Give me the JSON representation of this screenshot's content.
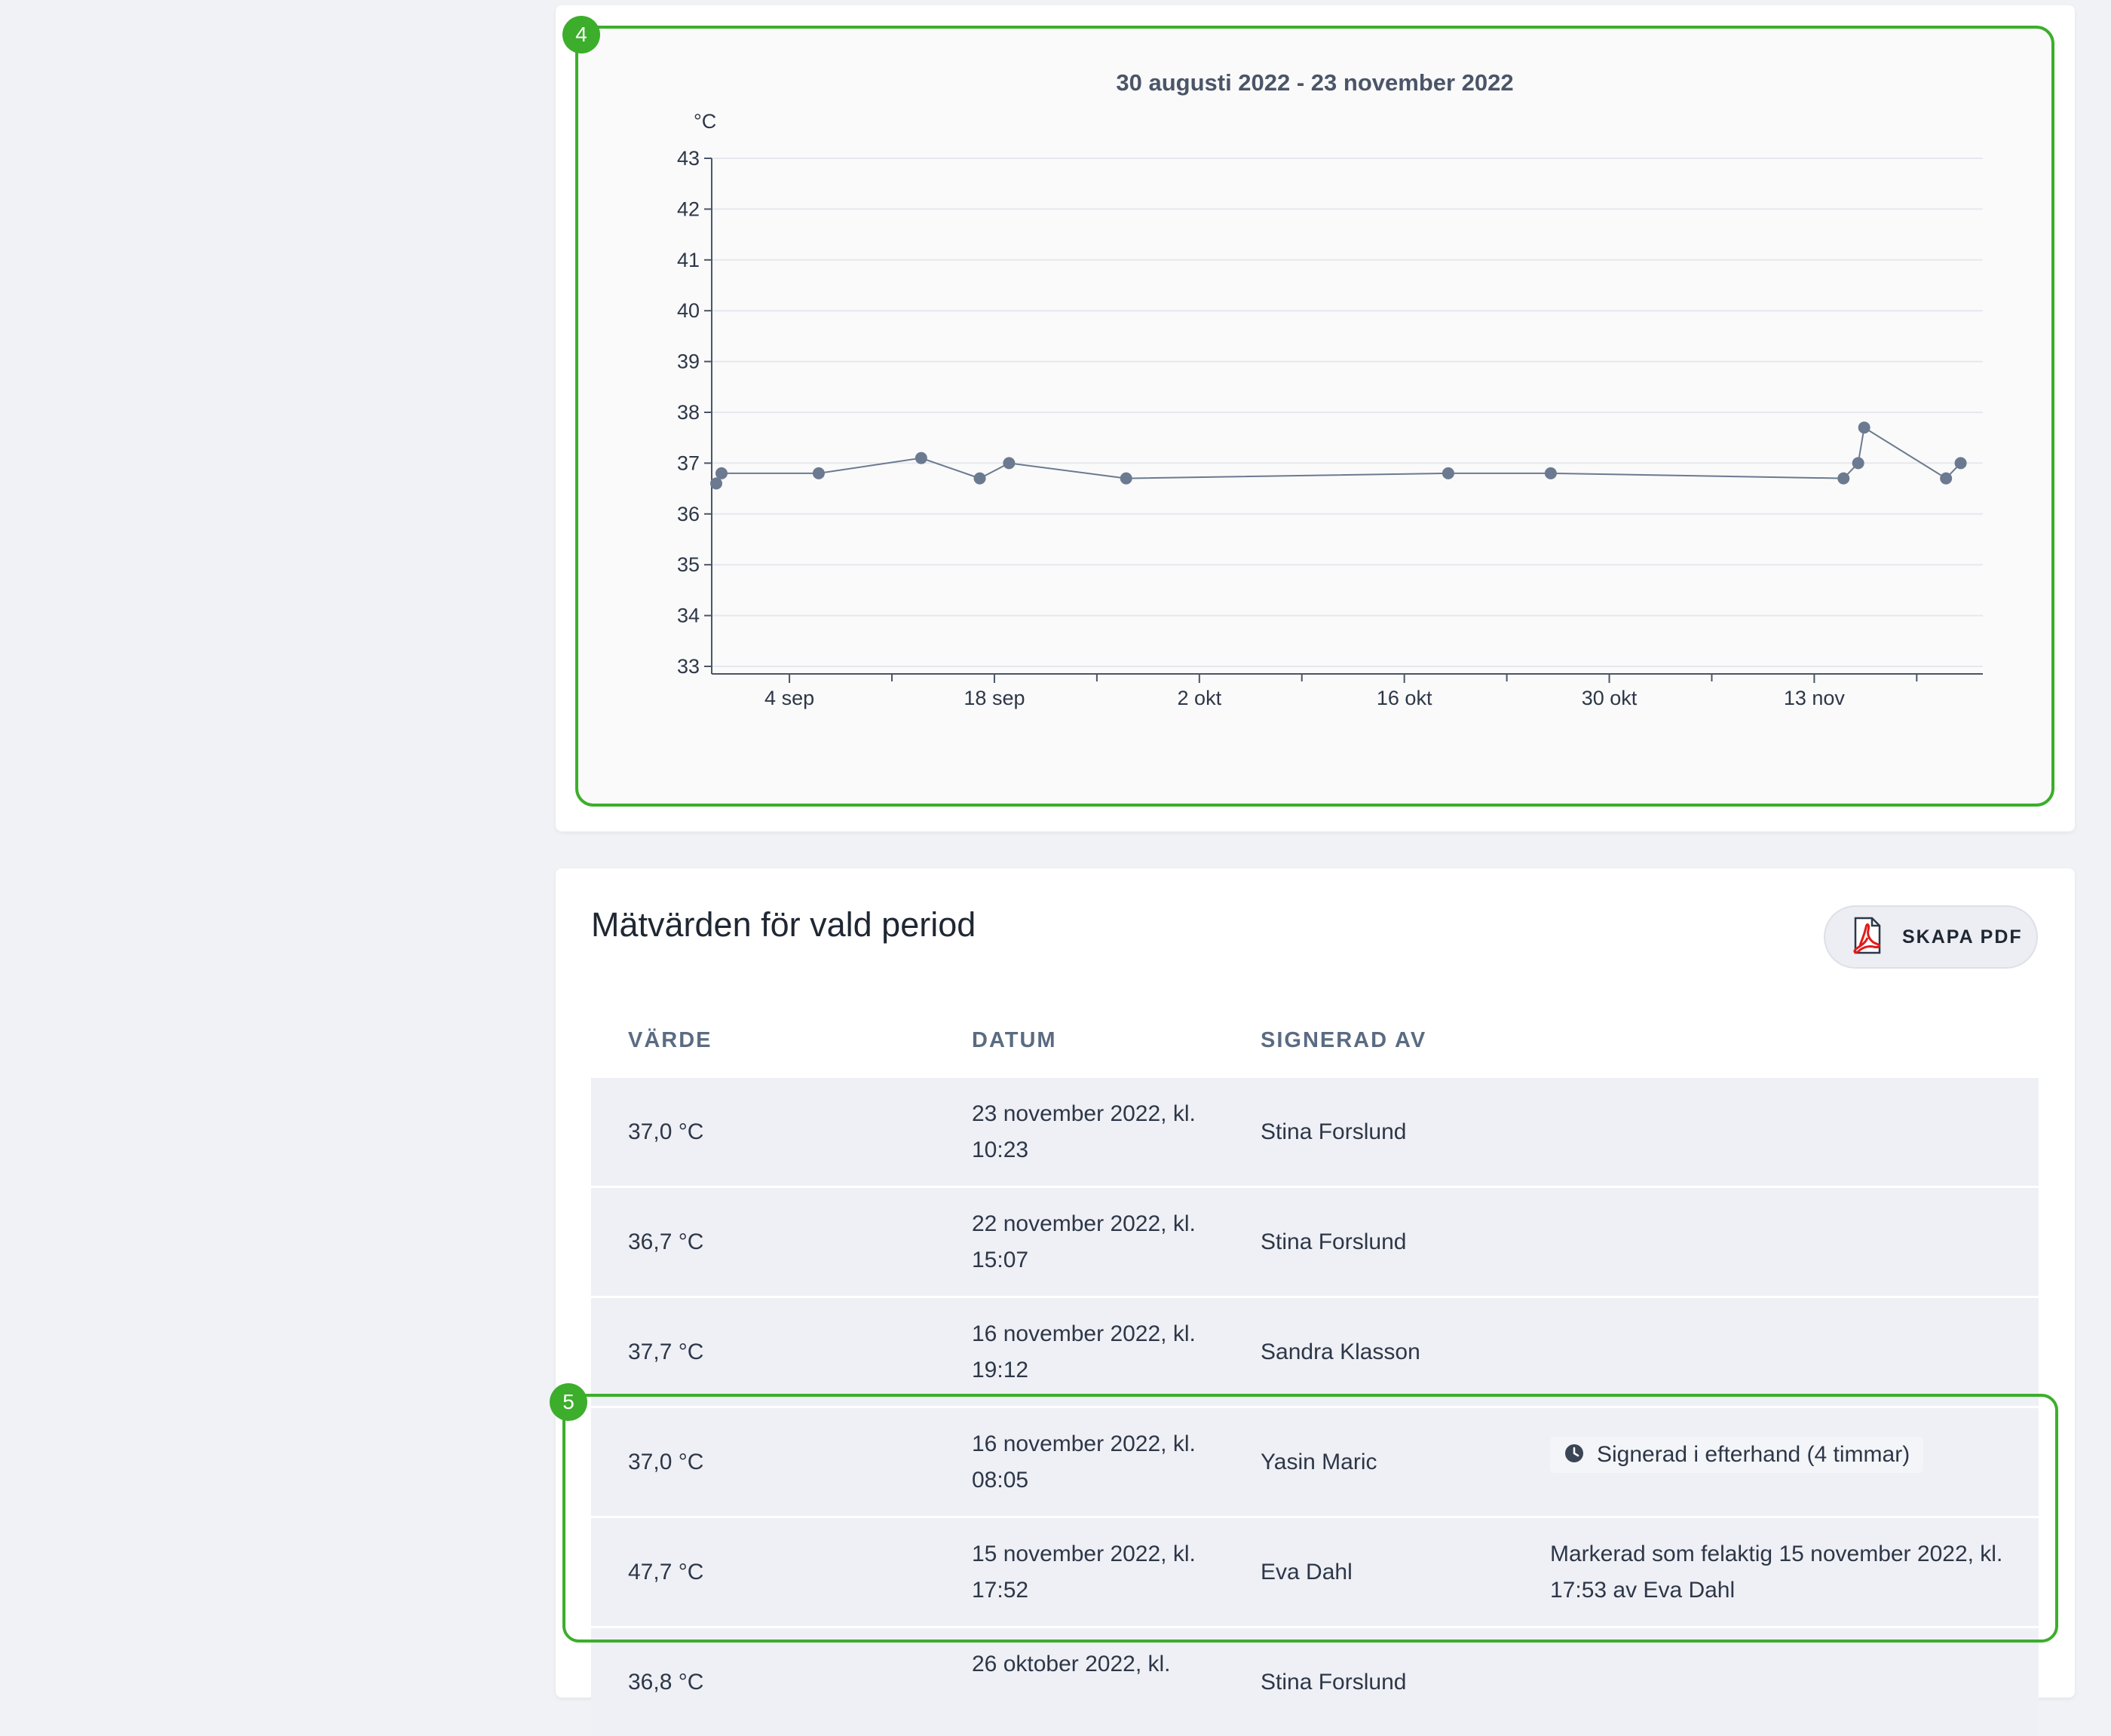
{
  "chart": {
    "badge": "4",
    "unit": "°C"
  },
  "chart_data": {
    "type": "line",
    "title": "30 augusti 2022 - 23 november 2022",
    "ylabel": "°C",
    "ylim": [
      33,
      43
    ],
    "yticks": [
      "33",
      "34",
      "35",
      "36",
      "37",
      "38",
      "39",
      "40",
      "41",
      "42",
      "43"
    ],
    "xlim": [
      "2022-08-30",
      "2022-11-24"
    ],
    "xticks": [
      {
        "date": "2022-09-04",
        "label": "4 sep"
      },
      {
        "date": "2022-09-18",
        "label": "18 sep"
      },
      {
        "date": "2022-10-02",
        "label": "2 okt"
      },
      {
        "date": "2022-10-16",
        "label": "16 okt"
      },
      {
        "date": "2022-10-30",
        "label": "30 okt"
      },
      {
        "date": "2022-11-13",
        "label": "13 nov"
      }
    ],
    "minor_xticks": [
      "2022-09-11",
      "2022-09-25",
      "2022-10-09",
      "2022-10-23",
      "2022-11-06",
      "2022-11-20"
    ],
    "grid": true,
    "series": [
      {
        "color": "#6b7a90",
        "points": [
          {
            "x": "2022-08-30",
            "y": 36.6
          },
          {
            "x": "2022-08-30",
            "y": 36.8
          },
          {
            "x": "2022-09-06",
            "y": 36.8
          },
          {
            "x": "2022-09-13",
            "y": 37.1
          },
          {
            "x": "2022-09-17",
            "y": 36.7
          },
          {
            "x": "2022-09-19",
            "y": 37.0
          },
          {
            "x": "2022-09-27",
            "y": 36.7
          },
          {
            "x": "2022-10-19",
            "y": 36.8
          },
          {
            "x": "2022-10-26",
            "y": 36.8
          },
          {
            "x": "2022-11-15",
            "y": 36.7
          },
          {
            "x": "2022-11-16",
            "y": 37.0
          },
          {
            "x": "2022-11-16",
            "y": 37.7
          },
          {
            "x": "2022-11-22",
            "y": 36.7
          },
          {
            "x": "2022-11-23",
            "y": 37.0
          }
        ]
      }
    ]
  },
  "table": {
    "title": "Mätvärden för vald period",
    "pdf_button": "SKAPA PDF",
    "pdf_icon": "pdf-icon",
    "headers": {
      "value": "VÄRDE",
      "date": "DATUM",
      "signed_by": "SIGNERAD AV"
    },
    "highlight_badge": "5",
    "rows": [
      {
        "value": "37,0 °C",
        "date_line1": "23 november 2022, kl.",
        "date_line2": "10:23",
        "signed_by": "Stina Forslund",
        "note1": "",
        "note2": ""
      },
      {
        "value": "36,7 °C",
        "date_line1": "22 november 2022, kl.",
        "date_line2": "15:07",
        "signed_by": "Stina Forslund",
        "note1": "",
        "note2": ""
      },
      {
        "value": "37,7 °C",
        "date_line1": "16 november 2022, kl.",
        "date_line2": "19:12",
        "signed_by": "Sandra Klasson",
        "note1": "",
        "note2": ""
      },
      {
        "value": "37,0 °C",
        "date_line1": "16 november 2022, kl.",
        "date_line2": "08:05",
        "signed_by": "Yasin Maric",
        "status": "Signerad i efterhand (4 timmar)",
        "status_icon": "clock-icon",
        "note1": "",
        "note2": ""
      },
      {
        "value": "47,7 °C",
        "date_line1": "15 november 2022, kl.",
        "date_line2": "17:52",
        "signed_by": "Eva Dahl",
        "note1": "Markerad som felaktig 15 november 2022, kl.",
        "note2": "17:53 av Eva Dahl"
      },
      {
        "value": "36,8 °C",
        "date_line1": "26 oktober 2022, kl.",
        "date_line2": "",
        "signed_by": "Stina Forslund",
        "note1": "",
        "note2": ""
      }
    ]
  }
}
